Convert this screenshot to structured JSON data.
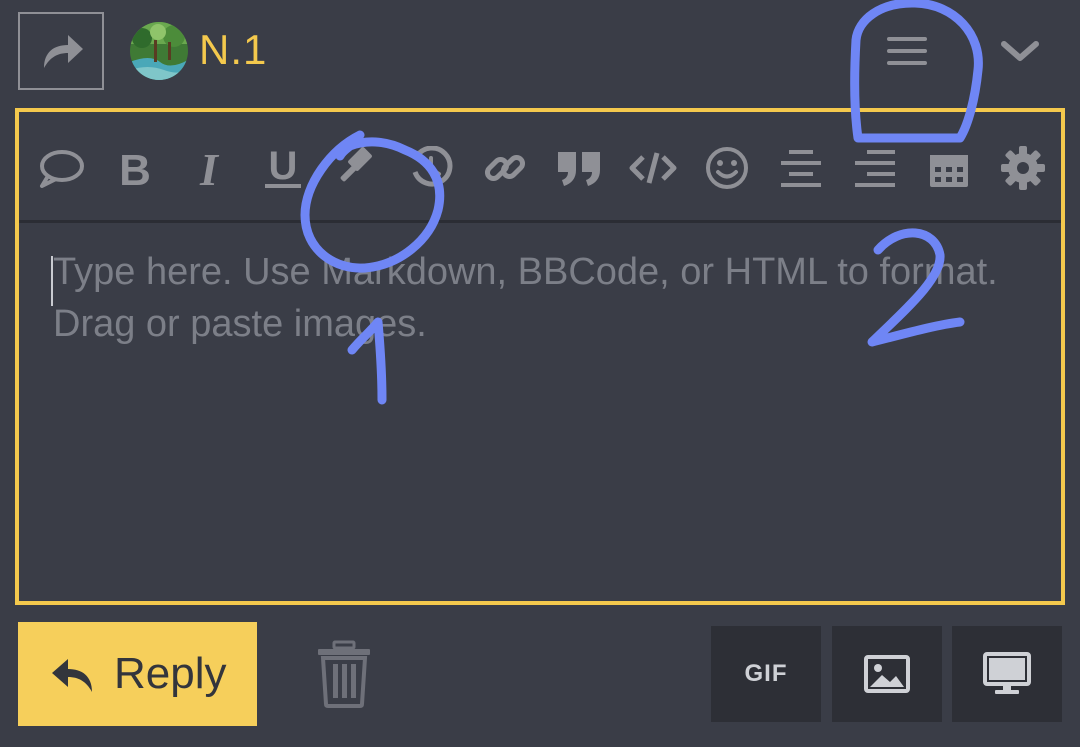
{
  "header": {
    "username": "N.1"
  },
  "editor": {
    "placeholder": "Type here. Use Markdown, BBCode, or HTML to format. Drag or paste images."
  },
  "toolbar": {
    "tools": [
      "speech-bubble-icon",
      "bold-icon",
      "italic-icon",
      "underline-icon",
      "gavel-icon",
      "history-icon",
      "link-icon",
      "quote-icon",
      "code-icon",
      "smiley-icon",
      "align-center-icon",
      "align-right-icon",
      "calendar-icon",
      "gear-icon"
    ]
  },
  "footer": {
    "reply_label": "Reply",
    "gif_label": "GIF"
  },
  "annotations": {
    "label_1": "1",
    "label_2": "2",
    "stroke_color": "#6f86f5"
  },
  "colors": {
    "accent": "#f4c94d",
    "background": "#3a3d47",
    "icon": "#8f9096"
  }
}
